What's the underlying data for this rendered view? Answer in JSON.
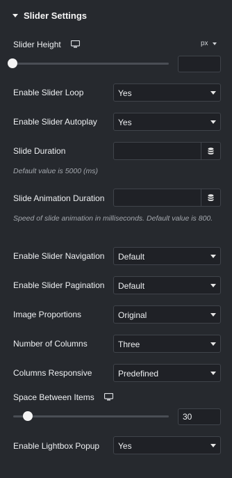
{
  "section": {
    "title": "Slider Settings"
  },
  "slider_height": {
    "label": "Slider Height",
    "device_icon": "desktop-icon",
    "unit": "px",
    "value": "",
    "level": 0
  },
  "enable_slider_loop": {
    "label": "Enable Slider Loop",
    "value": "Yes"
  },
  "enable_slider_autoplay": {
    "label": "Enable Slider Autoplay",
    "value": "Yes"
  },
  "slide_duration": {
    "label": "Slide Duration",
    "value": "",
    "help": "Default value is 5000 (ms)",
    "dynamic_icon": "database-icon"
  },
  "slide_animation_duration": {
    "label": "Slide Animation Duration",
    "value": "",
    "help": "Speed of slide animation in milliseconds. Default value is 800.",
    "dynamic_icon": "database-icon"
  },
  "enable_slider_navigation": {
    "label": "Enable Slider Navigation",
    "value": "Default"
  },
  "enable_slider_pagination": {
    "label": "Enable Slider Pagination",
    "value": "Default"
  },
  "image_proportions": {
    "label": "Image Proportions",
    "value": "Original"
  },
  "number_of_columns": {
    "label": "Number of Columns",
    "value": "Three"
  },
  "columns_responsive": {
    "label": "Columns Responsive",
    "value": "Predefined"
  },
  "space_between_items": {
    "label": "Space Between Items",
    "device_icon": "desktop-icon",
    "value": "30",
    "level": 0.1
  },
  "enable_lightbox_popup": {
    "label": "Enable Lightbox Popup",
    "value": "Yes"
  },
  "colors": {
    "panel_bg": "#26292e",
    "control_bg": "#1f2126",
    "control_border": "#40444b",
    "text": "#eef0f2",
    "help_text": "#a4a8ae"
  }
}
